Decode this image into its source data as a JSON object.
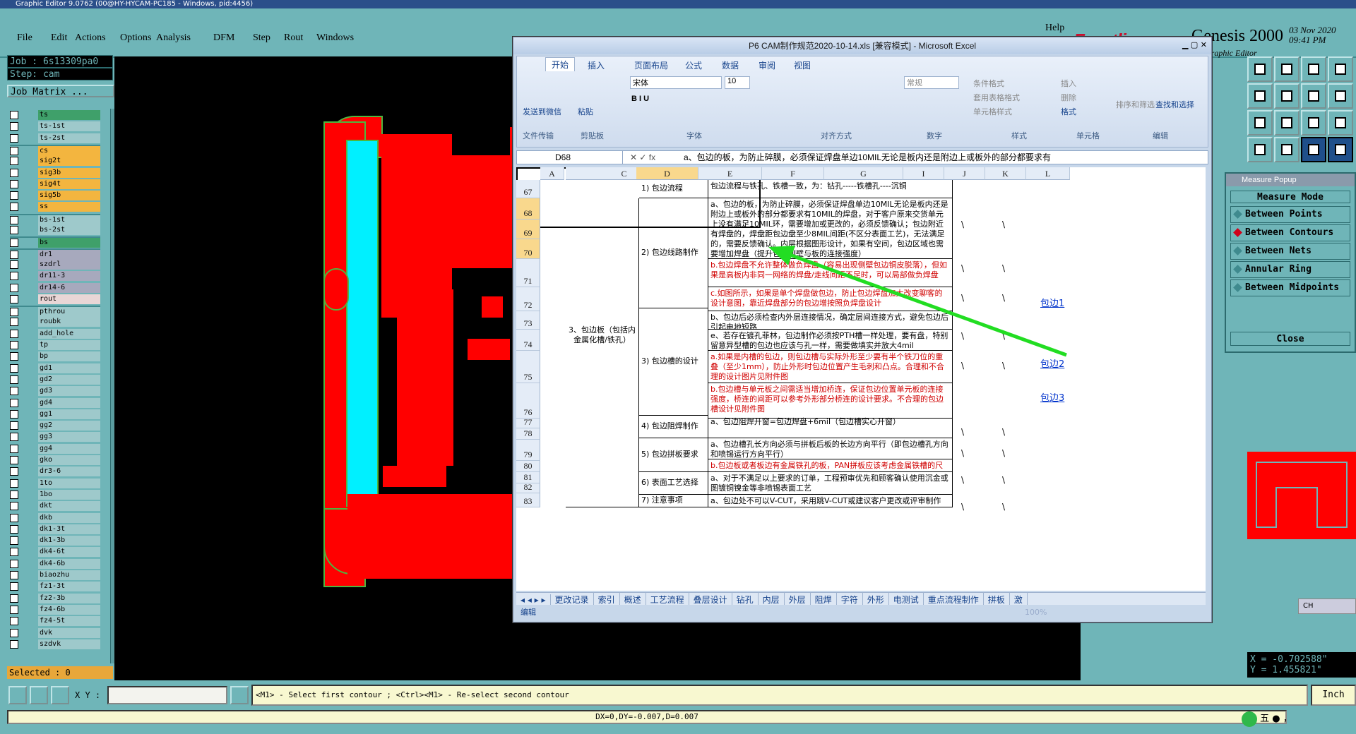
{
  "window": {
    "title": "Graphic Editor 9.0762 (00@HY-HYCAM-PC185 - Windows, pid:4456)"
  },
  "menu": [
    "File",
    "Edit",
    "Actions",
    "Options",
    "Analysis",
    "DFM",
    "Step",
    "Rout",
    "Windows"
  ],
  "help": "Help",
  "brand": {
    "logo": "Frontline",
    "product": "Genesis 2000",
    "subtitle": "Graphic Editor",
    "date": "03 Nov 2020",
    "time": "09:41 PM"
  },
  "job": {
    "job": "Job : 6s13309pa0",
    "step": "Step: cam",
    "matrix": "Job Matrix ..."
  },
  "layers": [
    {
      "name": "ts",
      "color": "#3fa06a"
    },
    {
      "name": "ts-1st",
      "color": "#9ec9cb"
    },
    {
      "name": "ts-2st",
      "color": "#9ec9cb"
    },
    {
      "name": "cs",
      "color": "#f3b53f",
      "sep": true
    },
    {
      "name": "sig2t",
      "color": "#f3b53f"
    },
    {
      "name": "sig3b",
      "color": "#f3b53f"
    },
    {
      "name": "sig4t",
      "color": "#f3b53f"
    },
    {
      "name": "sig5b",
      "color": "#f3b53f"
    },
    {
      "name": "ss",
      "color": "#f3b53f"
    },
    {
      "name": "bs-1st",
      "color": "#9ec9cb",
      "sep": true
    },
    {
      "name": "bs-2st",
      "color": "#9ec9cb"
    },
    {
      "name": "bs",
      "color": "#3fa06a",
      "sep": true
    },
    {
      "name": "dr1",
      "color": "#a7a9bd",
      "sep": true
    },
    {
      "name": "szdrl",
      "color": "#a7a9bd"
    },
    {
      "name": "dr11-3",
      "color": "#a7a9bd"
    },
    {
      "name": "dr14-6",
      "color": "#a7a9bd"
    },
    {
      "name": "rout",
      "color": "#e8d6d6"
    },
    {
      "name": "pthrou",
      "color": "#9ec9cb",
      "sep": true
    },
    {
      "name": "roubk",
      "color": "#9ec9cb"
    },
    {
      "name": "add_hole",
      "color": "#9ec9cb"
    },
    {
      "name": "tp",
      "color": "#9ec9cb"
    },
    {
      "name": "bp",
      "color": "#9ec9cb"
    },
    {
      "name": "gd1",
      "color": "#9ec9cb"
    },
    {
      "name": "gd2",
      "color": "#9ec9cb"
    },
    {
      "name": "gd3",
      "color": "#9ec9cb"
    },
    {
      "name": "gd4",
      "color": "#9ec9cb"
    },
    {
      "name": "gg1",
      "color": "#9ec9cb"
    },
    {
      "name": "gg2",
      "color": "#9ec9cb"
    },
    {
      "name": "gg3",
      "color": "#9ec9cb"
    },
    {
      "name": "gg4",
      "color": "#9ec9cb"
    },
    {
      "name": "gko",
      "color": "#9ec9cb"
    },
    {
      "name": "dr3-6",
      "color": "#9ec9cb"
    },
    {
      "name": "1to",
      "color": "#9ec9cb"
    },
    {
      "name": "1bo",
      "color": "#9ec9cb"
    },
    {
      "name": "dkt",
      "color": "#9ec9cb"
    },
    {
      "name": "dkb",
      "color": "#9ec9cb"
    },
    {
      "name": "dk1-3t",
      "color": "#9ec9cb"
    },
    {
      "name": "dk1-3b",
      "color": "#9ec9cb"
    },
    {
      "name": "dk4-6t",
      "color": "#9ec9cb"
    },
    {
      "name": "dk4-6b",
      "color": "#9ec9cb"
    },
    {
      "name": "biaozhu",
      "color": "#9ec9cb"
    },
    {
      "name": "fz1-3t",
      "color": "#9ec9cb"
    },
    {
      "name": "fz2-3b",
      "color": "#9ec9cb"
    },
    {
      "name": "fz4-6b",
      "color": "#9ec9cb"
    },
    {
      "name": "fz4-5t",
      "color": "#9ec9cb"
    },
    {
      "name": "dvk",
      "color": "#9ec9cb"
    },
    {
      "name": "szdvk",
      "color": "#9ec9cb"
    }
  ],
  "selected": "Selected : 0",
  "excel": {
    "title": "P6 CAM制作规范2020-10-14.xls [兼容模式] - Microsoft Excel",
    "tabs": [
      "开始",
      "插入",
      "页面布局",
      "公式",
      "数据",
      "审阅",
      "视图"
    ],
    "ribbon": {
      "paste_wechat": "发送到微信",
      "file_transfer": "文件传输",
      "paste": "粘贴",
      "clipboard": "剪贴板",
      "font_name": "宋体",
      "font_size": "10",
      "font": "字体",
      "align": "对齐方式",
      "num_fmt": "常规",
      "number": "数字",
      "cond_fmt": "条件格式",
      "table_fmt": "套用表格格式",
      "cell_style": "单元格样式",
      "styles": "样式",
      "insert": "插入",
      "delete": "删除",
      "format": "格式",
      "cells": "单元格",
      "sort": "排序和筛选",
      "find": "查找和选择",
      "edit": "编辑"
    },
    "namebox": "D68",
    "fx": "fx",
    "formula": "a、包边的板，为防止碎膜，必须保证焊盘单边10MIL无论是板内还是附边上或板外的部分都要求有",
    "cols": [
      "A",
      "B",
      "C",
      "D",
      "E",
      "F",
      "G",
      "I",
      "J",
      "K",
      "L"
    ],
    "rows": [
      "67",
      "68",
      "69",
      "70",
      "71",
      "72",
      "73",
      "74",
      "75",
      "76",
      "77",
      "78",
      "79",
      "80",
      "81",
      "82",
      "83"
    ],
    "b_text": "3、包边板（包括内金属化槽/铁孔）",
    "c": [
      "1) 包边流程",
      "2) 包边线路制作",
      "3) 包边槽的设计",
      "4) 包边阻焊制作",
      "5) 包边拼板要求",
      "6) 表面工艺选择",
      "7) 注意事项"
    ],
    "d": [
      {
        "t": "包边流程与铁孔、铁槽一致，为：钻孔-----铁槽孔----沉铜",
        "red": false
      },
      {
        "t": "a、包边的板，为防止碎膜，必须保证焊盘单边10MIL无论是板内还是附边上或板外的部分都要求有10MIL的焊盘，对于客户原来交货单元上没有满足10MIL环，需要增加或更改的，必须反馈确认；包边附近有焊盘的，焊盘距包边盘至少8MIL间距(不区分表面工艺)，无法满足的，需要反馈确认。内层根据图形设计，如果有空间，包边区域也需要增加焊盘（提升包边侧壁与板的连接强度）",
        "red": false
      },
      {
        "t": "b.包边焊盘不允许整体做负焊盘（容易出现侧壁包边铜皮脱落），但如果是高板内非同一网络的焊盘/走线间距不足时，可以局部做负焊盘",
        "red": true
      },
      {
        "t": "c.如图所示，如果是单个焊盘做包边，防止包边焊盘加大改变聊客的设计意图，靠近焊盘部分的包边增按照负焊盘设计",
        "red": true
      },
      {
        "t": "b、包边后必须检查内外层连接情况，确定层间连接方式，避免包边后引起电地短路",
        "red": false
      },
      {
        "t": "e、若存在镀孔菲林，包边制作必须按PTH槽一样处理，要有盘，特别留意异型槽的包边也应该与孔一样，需要做填实并放大4mil",
        "red": false
      },
      {
        "t": "a.如果是内槽的包边，则包边槽与实际外形至少要有半个铁刀位的重叠（至少1mm），防止外形时包边位置产生毛刺和凸点。合理和不合理的设计图片见附件图",
        "red": true
      },
      {
        "t": "b.包边槽与单元板之间需适当增加桥连，保证包边位置单元板的连接强度，桥连的间距可以参考外形部分桥连的设计要求。不合理的包边槽设计见附件图",
        "red": true
      },
      {
        "t": "a、包边阻焊开窗=包边焊盘+6mil（包边槽实心开窗）",
        "red": false
      },
      {
        "t": "a、包边槽孔长方向必须与拼板后板的长边方向平行（即包边槽孔方向和喷锡运行方向平行）",
        "red": false
      },
      {
        "t": "b.包边板或者板边有金属铁孔的板，PAN拼板应该考虑金属铁槽的尺寸",
        "red": true
      },
      {
        "t": "a、对于不满足以上要求的订单，工程预审优先和顾客确认使用沉金或图镀铜镍金等非喷锡表面工艺",
        "red": false
      },
      {
        "t": "a、包边处不可以V-CUT，采用跳V-CUT或建议客户更改或评审制作",
        "red": false
      }
    ],
    "slash": "\\",
    "links": [
      "包边1",
      "包边2",
      "包边3"
    ],
    "sheets": [
      "更改记录",
      "索引",
      "概述",
      "工艺流程",
      "叠层设计",
      "钻孔",
      "内层",
      "外层",
      "阻焊",
      "字符",
      "外形",
      "电测试",
      "重点流程制作",
      "拼板",
      "激"
    ],
    "status": "编辑",
    "zoom": "100%"
  },
  "measure": {
    "title": "Measure Popup",
    "mode": "Measure Mode",
    "options": [
      "Between Points",
      "Between Contours",
      "Between Nets",
      "Annular Ring",
      "Between Midpoints"
    ],
    "selected": 1,
    "close": "Close"
  },
  "coords": {
    "x": "X = -0.702588\"",
    "y": "Y = 1.455821\""
  },
  "ime": "CH",
  "bottom": {
    "xy": "X Y :",
    "prompt": "<M1> - Select first contour ; <Ctrl><M1> - Re-select second contour",
    "unit": "Inch",
    "dx": "DX=0,DY=-0.007,D=0.007",
    "tray": "五 ● ，"
  }
}
